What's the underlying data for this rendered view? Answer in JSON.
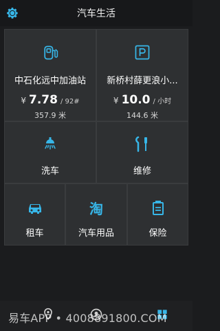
{
  "header": {
    "title": "汽车生活",
    "settings_icon": "gear-icon"
  },
  "colors": {
    "accent": "#37b6e8",
    "background": "#1b1c1e",
    "tile": "#2e3032"
  },
  "gas": {
    "name": "中石化远中加油站",
    "currency": "¥",
    "price": "7.78",
    "unit": "/ 92#",
    "distance": "357.9 米",
    "icon": "gas-pump-icon"
  },
  "parking": {
    "name": "新桥村薛更浪小...",
    "currency": "¥",
    "price": "10.0",
    "unit": "/ 小时",
    "distance": "144.6 米",
    "icon": "parking-icon"
  },
  "services": {
    "wash": {
      "label": "洗车",
      "icon": "car-wash-icon"
    },
    "repair": {
      "label": "维修",
      "icon": "wrench-screwdriver-icon"
    },
    "rent": {
      "label": "租车",
      "icon": "car-icon"
    },
    "goods": {
      "label": "汽车用品",
      "icon": "taobao-icon"
    },
    "insurance": {
      "label": "保险",
      "icon": "insurance-icon"
    }
  },
  "bottom_nav": {
    "items": [
      {
        "icon": "map-pin-icon"
      },
      {
        "icon": "profile-icon"
      },
      {
        "icon": "services-icon",
        "active": true
      }
    ]
  },
  "watermark": {
    "text": "易车APP • 4008891800.COM"
  }
}
